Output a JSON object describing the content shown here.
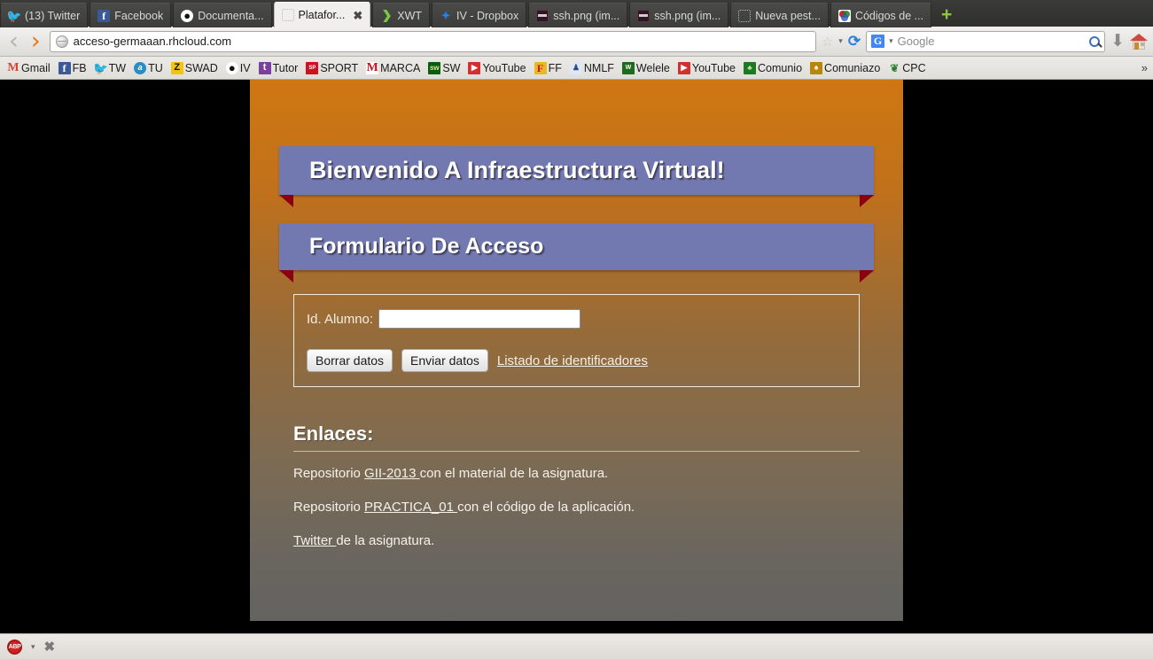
{
  "browser": {
    "tabs": [
      {
        "title": "(13) Twitter",
        "favicon": "twitter-icon",
        "active": false
      },
      {
        "title": "Facebook",
        "favicon": "facebook-icon",
        "active": false
      },
      {
        "title": "Documenta...",
        "favicon": "github-icon",
        "active": false
      },
      {
        "title": "Platafor...",
        "favicon": "blank-page-icon",
        "active": true
      },
      {
        "title": "XWT",
        "favicon": "xwt-icon",
        "active": false
      },
      {
        "title": "IV - Dropbox",
        "favicon": "dropbox-icon",
        "active": false
      },
      {
        "title": "ssh.png (im...",
        "favicon": "image-file-icon",
        "active": false
      },
      {
        "title": "ssh.png (im...",
        "favicon": "image-file-icon",
        "active": false
      },
      {
        "title": "Nueva pest...",
        "favicon": "blank-page-icon",
        "active": false
      },
      {
        "title": "Códigos de ...",
        "favicon": "codigos-icon",
        "active": false
      }
    ],
    "new_tab_label": "+",
    "tab_close_label": "✖",
    "nav": {
      "back_label": "‹",
      "forward_label": "›",
      "url": "acceso-germaaan.rhcloud.com",
      "star_label": "☆",
      "caret_label": "▾",
      "reload_label": "⟳",
      "download_label": "⬇",
      "home_label": "home-icon"
    },
    "search": {
      "engine": "G",
      "placeholder": "Google",
      "value": ""
    },
    "bookmarks": [
      {
        "label": "Gmail",
        "icon": "gmail-icon",
        "glyph": "M"
      },
      {
        "label": "FB",
        "icon": "facebook-icon",
        "glyph": "f"
      },
      {
        "label": "TW",
        "icon": "twitter-icon",
        "glyph": "🐦"
      },
      {
        "label": "TU",
        "icon": "tuenti-icon",
        "glyph": "a"
      },
      {
        "label": "SWAD",
        "icon": "swad-icon",
        "glyph": "Z"
      },
      {
        "label": "IV",
        "icon": "github-icon",
        "glyph": "●"
      },
      {
        "label": "Tutor",
        "icon": "tutor-icon",
        "glyph": "t"
      },
      {
        "label": "SPORT",
        "icon": "sport-icon",
        "glyph": "SP"
      },
      {
        "label": "MARCA",
        "icon": "marca-icon",
        "glyph": "M"
      },
      {
        "label": "SW",
        "icon": "sw-icon",
        "glyph": "sw"
      },
      {
        "label": "YouTube",
        "icon": "youtube-icon",
        "glyph": "▶"
      },
      {
        "label": "FF",
        "icon": "ff-icon",
        "glyph": "F"
      },
      {
        "label": "NMLF",
        "icon": "nmlf-icon",
        "glyph": "♟"
      },
      {
        "label": "Welele",
        "icon": "welele-icon",
        "glyph": "W"
      },
      {
        "label": "YouTube",
        "icon": "youtube-icon",
        "glyph": "▶"
      },
      {
        "label": "Comunio",
        "icon": "comunio-icon",
        "glyph": "♣"
      },
      {
        "label": "Comuniazo",
        "icon": "comuniazo-icon",
        "glyph": "♠"
      },
      {
        "label": "CPC",
        "icon": "cpc-icon",
        "glyph": "❦"
      }
    ],
    "bookmarks_overflow_label": "»"
  },
  "page": {
    "banner_title": "Bienvenido A Infraestructura Virtual!",
    "form_title": "Formulario De Acceso",
    "form": {
      "field_label": "Id. Alumno:",
      "field_value": "",
      "field_placeholder": "",
      "clear_button": "Borrar datos",
      "submit_button": "Enviar datos",
      "list_link": "Listado de identificadores"
    },
    "links": {
      "heading": "Enlaces:",
      "items": [
        {
          "prefix": "Repositorio ",
          "link": "GII-2013 ",
          "suffix": "con el material de la asignatura."
        },
        {
          "prefix": "Repositorio ",
          "link": "PRACTICA_01 ",
          "suffix": "con el código de la aplicación."
        },
        {
          "prefix": "",
          "link": "Twitter ",
          "suffix": "de la asignatura."
        }
      ]
    },
    "colors": {
      "banner": "#7278b0",
      "ribbon_fold": "#8b0010",
      "background_top": "#cf7712",
      "background_bottom": "#636360"
    }
  },
  "statusbar": {
    "adblock_label": "ABP",
    "adblock_caret": "▾",
    "close_label": "✖"
  }
}
